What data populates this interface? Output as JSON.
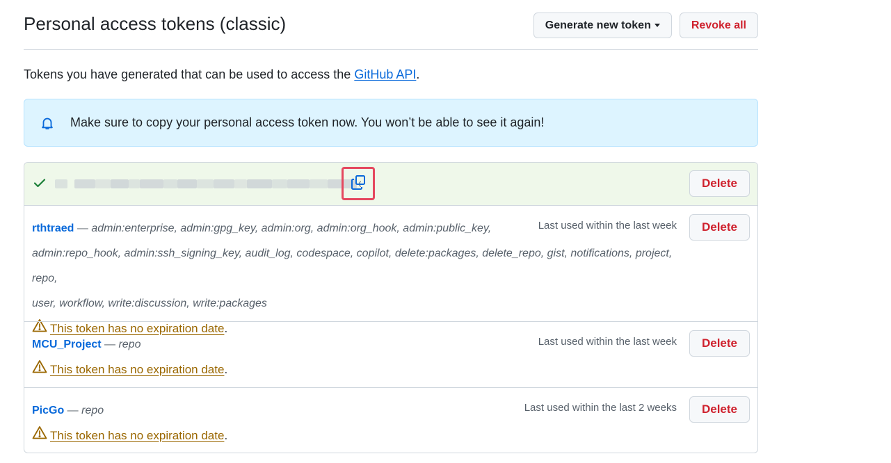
{
  "header": {
    "title": "Personal access tokens (classic)",
    "generate_label": "Generate new token",
    "revoke_label": "Revoke all"
  },
  "intro": {
    "prefix": "Tokens you have generated that can be used to access the ",
    "link": "GitHub API",
    "suffix": "."
  },
  "flash": {
    "icon": "bell-icon",
    "message": "Make sure to copy your personal access token now. You won’t be able to see it again!"
  },
  "new_token": {
    "value_tail": "e",
    "delete_label": "Delete",
    "colors": {
      "bg": "#eff8ea",
      "check": "#1a7f37",
      "highlight": "#e5485f"
    }
  },
  "tokens": [
    {
      "name": "rthtraed",
      "separator": " — ",
      "scopes_line1": "admin:enterprise, admin:gpg_key, admin:org, admin:org_hook, admin:public_key,",
      "scopes_line2": "admin:repo_hook, admin:ssh_signing_key, audit_log, codespace, copilot, delete:packages, delete_repo, gist, notifications, project, repo,",
      "scopes_line3": "user, workflow, write:discussion, write:packages",
      "last_used": "Last used within the last week",
      "warning": "This token has no expiration date",
      "warning_suffix": ".",
      "delete_label": "Delete"
    },
    {
      "name": "MCU_Project",
      "separator": " — ",
      "scopes_line1": "repo",
      "last_used": "Last used within the last week",
      "warning": "This token has no expiration date",
      "warning_suffix": ".",
      "delete_label": "Delete"
    },
    {
      "name": "PicGo",
      "separator": " — ",
      "scopes_line1": "repo",
      "last_used": "Last used within the last 2 weeks",
      "warning": "This token has no expiration date",
      "warning_suffix": ".",
      "delete_label": "Delete"
    }
  ],
  "colors": {
    "link": "#0969da",
    "danger": "#cf222e",
    "warning": "#9a6700",
    "flash_bg": "#ddf4ff"
  }
}
